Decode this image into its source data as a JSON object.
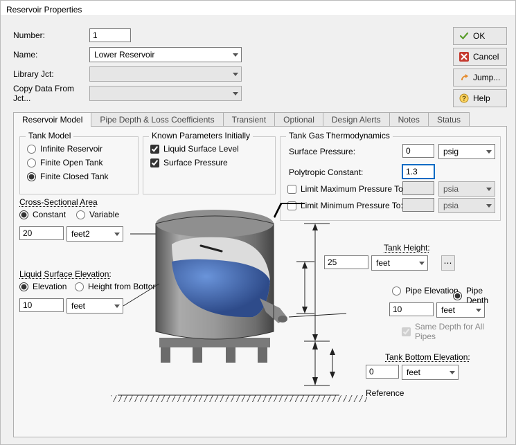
{
  "window": {
    "title": "Reservoir Properties"
  },
  "header": {
    "labels": {
      "number": "Number:",
      "name": "Name:",
      "library": "Library Jct:",
      "copy": "Copy Data From Jct..."
    },
    "values": {
      "number": "1",
      "name": "Lower Reservoir",
      "library": "",
      "copy": ""
    }
  },
  "buttons": {
    "ok": "OK",
    "cancel": "Cancel",
    "jump": "Jump...",
    "help": "Help"
  },
  "tabs": [
    "Reservoir Model",
    "Pipe Depth & Loss Coefficients",
    "Transient",
    "Optional",
    "Design Alerts",
    "Notes",
    "Status"
  ],
  "groups": {
    "tankModel": "Tank Model",
    "knownParams": "Known Parameters Initially",
    "tankGas": "Tank Gas Thermodynamics"
  },
  "tankModel": {
    "options": [
      "Infinite Reservoir",
      "Finite Open Tank",
      "Finite Closed Tank"
    ],
    "selected": "Finite Closed Tank"
  },
  "knownParams": {
    "options": [
      "Liquid Surface Level",
      "Surface Pressure"
    ],
    "checked": [
      true,
      true
    ]
  },
  "gas": {
    "labels": {
      "surfacePressure": "Surface Pressure:",
      "polytropic": "Polytropic Constant:",
      "limitMax": "Limit Maximum Pressure To:",
      "limitMin": "Limit Minimum Pressure To:"
    },
    "values": {
      "surfacePressure": "0",
      "polytropic": "1.3",
      "limitMax": "",
      "limitMin": ""
    },
    "units": {
      "surfacePressure": "psig",
      "limitMax": "psia",
      "limitMin": "psia"
    },
    "limitMaxChecked": false,
    "limitMinChecked": false
  },
  "crossSection": {
    "label": "Cross-Sectional Area",
    "options": [
      "Constant",
      "Variable"
    ],
    "selected": "Constant",
    "value": "20",
    "unit": "feet2"
  },
  "liquidSurface": {
    "label": "Liquid Surface Elevation:",
    "options": [
      "Elevation",
      "Height from Bottom"
    ],
    "selected": "Elevation",
    "value": "10",
    "unit": "feet"
  },
  "tankHeight": {
    "label": "Tank Height:",
    "value": "25",
    "unit": "feet"
  },
  "pipe": {
    "options": [
      "Pipe Elevation",
      "Pipe Depth"
    ],
    "selected": "Pipe Depth",
    "value": "10",
    "unit": "feet",
    "sameDepth": "Same Depth for All Pipes",
    "sameDepthChecked": true
  },
  "tankBottom": {
    "label": "Tank Bottom Elevation:",
    "value": "0",
    "unit": "feet"
  },
  "labels": {
    "reference": "Reference"
  }
}
